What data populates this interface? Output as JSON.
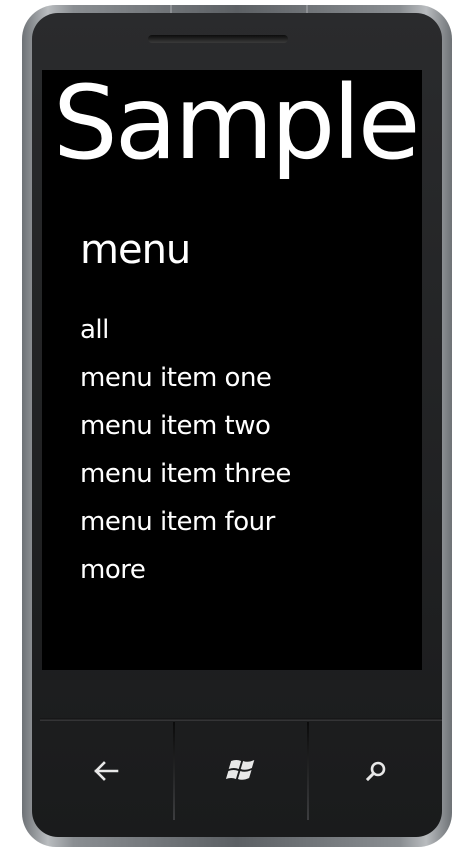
{
  "app": {
    "title": "Sample"
  },
  "page": {
    "title": "menu"
  },
  "menu": {
    "items": [
      {
        "label": "all"
      },
      {
        "label": "menu item one"
      },
      {
        "label": "menu item two"
      },
      {
        "label": "menu item three"
      },
      {
        "label": "menu item four"
      },
      {
        "label": "more"
      }
    ]
  },
  "hardware_buttons": [
    {
      "icon": "back-arrow-icon"
    },
    {
      "icon": "windows-logo-icon"
    },
    {
      "icon": "search-icon"
    }
  ],
  "colors": {
    "screen_background": "#000000",
    "text": "#ffffff"
  }
}
